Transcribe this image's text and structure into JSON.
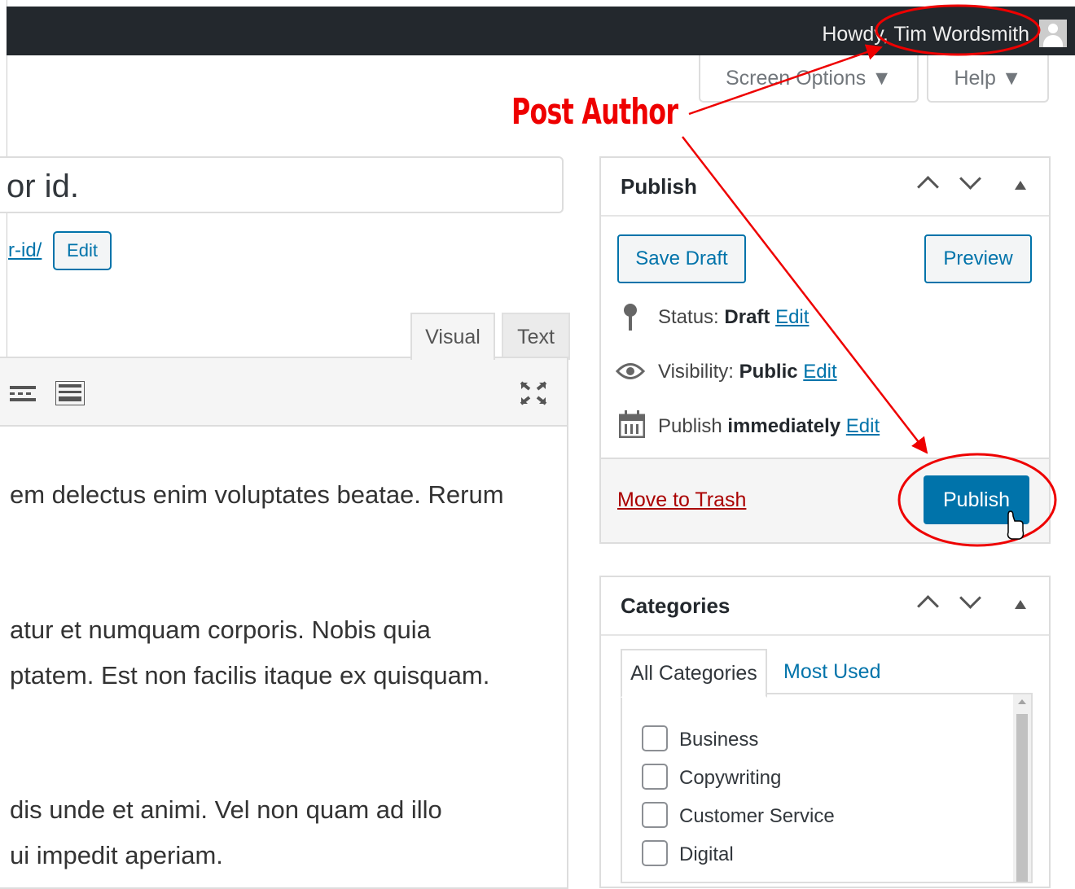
{
  "admin_bar": {
    "greeting": "Howdy, Tim Wordsmith"
  },
  "screen_meta": {
    "screen_options": "Screen Options ▼",
    "help": "Help ▼"
  },
  "annotation": {
    "label": "Post Author",
    "color": "#e00000"
  },
  "title": {
    "value": "or id."
  },
  "permalink": {
    "slug": "r-id/",
    "edit": "Edit"
  },
  "editor": {
    "tabs": [
      "Visual",
      "Text"
    ],
    "lines": [
      "em delectus enim voluptates beatae. Rerum",
      "atur et numquam corporis. Nobis quia",
      "ptatem. Est non facilis itaque ex quisquam.",
      "dis unde et animi. Vel non quam ad illo",
      "ui impedit aperiam."
    ]
  },
  "publish_box": {
    "title": "Publish",
    "save_draft": "Save Draft",
    "preview": "Preview",
    "status_label": "Status:",
    "status_value": "Draft",
    "visibility_label": "Visibility:",
    "visibility_value": "Public",
    "publish_label": "Publish",
    "publish_value": "immediately",
    "edit": "Edit",
    "trash": "Move to Trash",
    "publish_button": "Publish",
    "accent": "#0073aa"
  },
  "categories_box": {
    "title": "Categories",
    "tabs": [
      "All Categories",
      "Most Used"
    ],
    "items": [
      "Business",
      "Copywriting",
      "Customer Service",
      "Digital"
    ]
  }
}
